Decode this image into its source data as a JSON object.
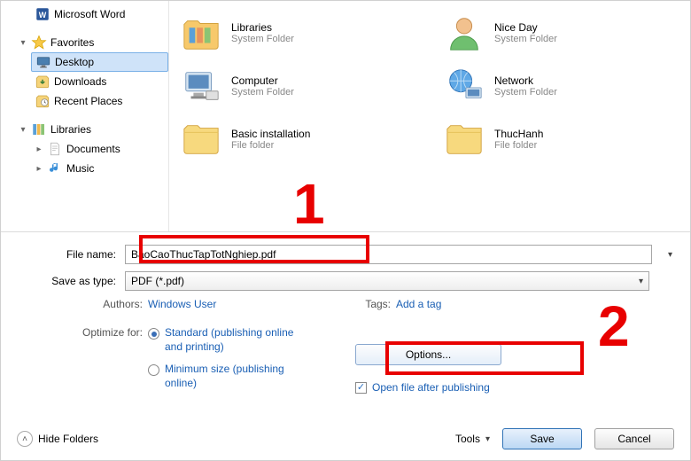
{
  "sidebar": {
    "word": "Microsoft Word",
    "favorites": "Favorites",
    "desktop": "Desktop",
    "downloads": "Downloads",
    "recent": "Recent Places",
    "libraries": "Libraries",
    "documents": "Documents",
    "music": "Music"
  },
  "grid": {
    "items": [
      {
        "name": "Libraries",
        "sub": "System Folder"
      },
      {
        "name": "Nice Day",
        "sub": "System Folder"
      },
      {
        "name": "Computer",
        "sub": "System Folder"
      },
      {
        "name": "Network",
        "sub": "System Folder"
      },
      {
        "name": "Basic installation",
        "sub": "File folder"
      },
      {
        "name": "ThucHanh",
        "sub": "File folder"
      }
    ]
  },
  "form": {
    "filename_label": "File name:",
    "filename_value": "BaoCaoThucTapTotNghiep.pdf",
    "type_label": "Save as type:",
    "type_value": "PDF (*.pdf)",
    "authors_label": "Authors:",
    "authors_value": "Windows User",
    "tags_label": "Tags:",
    "tags_value": "Add a tag",
    "optimize_label": "Optimize for:",
    "optimize_standard": "Standard (publishing online and printing)",
    "optimize_min": "Minimum size (publishing online)",
    "options_btn": "Options...",
    "open_after": "Open file after publishing"
  },
  "footer": {
    "hide": "Hide Folders",
    "tools": "Tools",
    "save": "Save",
    "cancel": "Cancel"
  },
  "annotations": {
    "n1": "1",
    "n2": "2"
  }
}
